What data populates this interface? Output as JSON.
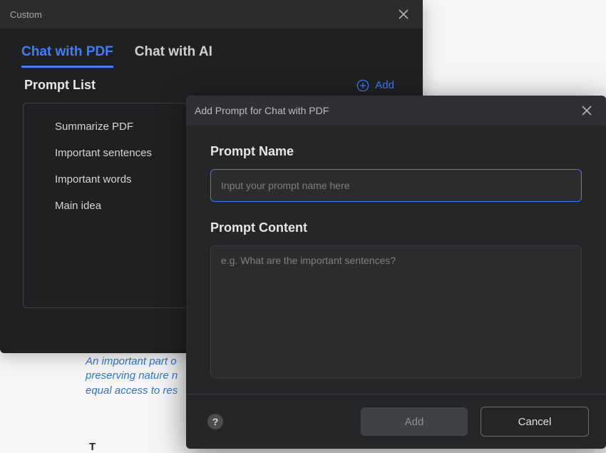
{
  "panel": {
    "title": "Custom"
  },
  "tabs": {
    "pdf": "Chat with PDF",
    "ai": "Chat with AI"
  },
  "promptList": {
    "title": "Prompt List",
    "addLabel": "Add",
    "items": [
      "Summarize PDF",
      "Important sentences",
      "Important words",
      "Main idea"
    ]
  },
  "bgText": {
    "line1": "An important part o",
    "line2": "preserving nature n",
    "line3": "equal access to res"
  },
  "bottomText": "T",
  "dialog": {
    "title": "Add Prompt for Chat with PDF",
    "nameLabel": "Prompt Name",
    "namePlaceholder": "Input your prompt name here",
    "contentLabel": "Prompt Content",
    "contentPlaceholder": "e.g. What are the important sentences?",
    "addBtn": "Add",
    "cancelBtn": "Cancel",
    "helpTooltip": "?"
  }
}
